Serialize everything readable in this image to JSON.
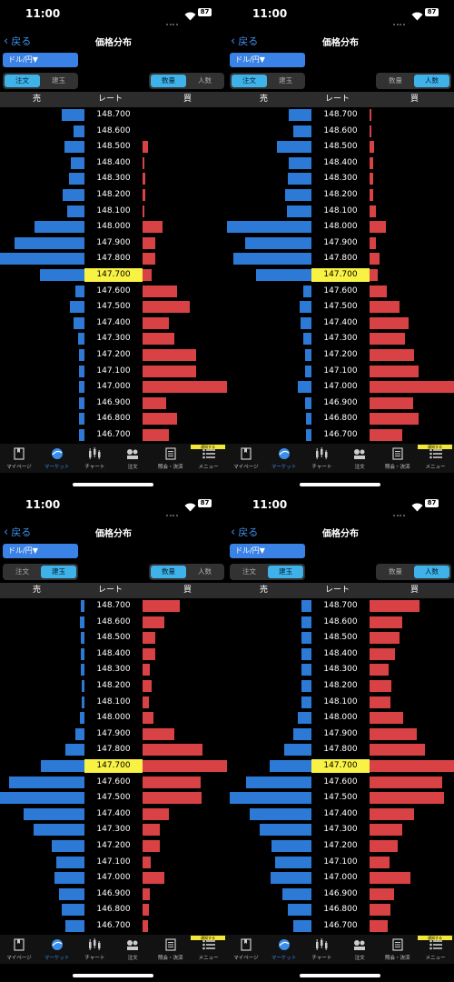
{
  "status": {
    "time": "11:00",
    "battery": "87"
  },
  "nav": {
    "back_label": "戻る",
    "title": "価格分布"
  },
  "pair_selector": "ドル/円▼",
  "toggles": {
    "order_label": "注文",
    "position_label": "建玉",
    "quantity_label": "数量",
    "people_label": "人数"
  },
  "headers": {
    "sell": "売",
    "rate": "レート",
    "buy": "買"
  },
  "prices": [
    "148.700",
    "148.600",
    "148.500",
    "148.400",
    "148.300",
    "148.200",
    "148.100",
    "148.000",
    "147.900",
    "147.800",
    "147.700",
    "147.600",
    "147.500",
    "147.400",
    "147.300",
    "147.200",
    "147.100",
    "147.000",
    "146.900",
    "146.800",
    "146.700"
  ],
  "current_price": "147.700",
  "tabs": [
    {
      "label": "マイページ",
      "icon": "bookmark-icon"
    },
    {
      "label": "マーケット",
      "icon": "market-globe-icon"
    },
    {
      "label": "チャート",
      "icon": "candlestick-icon"
    },
    {
      "label": "注文",
      "icon": "order-icon"
    },
    {
      "label": "照会・決済",
      "icon": "document-icon"
    },
    {
      "label": "メニュー",
      "icon": "menu-list-icon"
    }
  ],
  "menu_badge": "通知する",
  "colors": {
    "sell": "#2c7ad6",
    "buy": "#d94245",
    "current": "#f8f244",
    "accent": "#3b8ee8",
    "toggle_on": "#3fb3e9"
  },
  "panels": [
    {
      "position": "top-left",
      "toggle_left_active": "order",
      "toggle_right_active": "quantity",
      "sell": [
        0.27,
        0.13,
        0.24,
        0.16,
        0.18,
        0.26,
        0.2,
        0.59,
        0.83,
        1.0,
        0.53,
        0.11,
        0.17,
        0.13,
        0.08,
        0.06,
        0.06,
        0.07,
        0.06,
        0.06,
        0.06
      ],
      "buy": [
        0.0,
        0.0,
        0.06,
        0.02,
        0.03,
        0.03,
        0.02,
        0.24,
        0.15,
        0.15,
        0.11,
        0.41,
        0.56,
        0.31,
        0.38,
        0.63,
        0.63,
        1.0,
        0.28,
        0.41,
        0.31
      ]
    },
    {
      "position": "top-right",
      "toggle_left_active": "order",
      "toggle_right_active": "people",
      "sell": [
        0.27,
        0.21,
        0.41,
        0.27,
        0.28,
        0.31,
        0.29,
        1.0,
        0.79,
        0.92,
        0.66,
        0.1,
        0.14,
        0.13,
        0.1,
        0.08,
        0.08,
        0.16,
        0.08,
        0.06,
        0.06
      ],
      "buy": [
        0.02,
        0.02,
        0.05,
        0.04,
        0.04,
        0.04,
        0.08,
        0.19,
        0.08,
        0.12,
        0.1,
        0.2,
        0.35,
        0.46,
        0.42,
        0.53,
        0.58,
        1.0,
        0.52,
        0.58,
        0.39
      ]
    },
    {
      "position": "bottom-left",
      "toggle_left_active": "position",
      "toggle_right_active": "quantity",
      "sell": [
        0.04,
        0.05,
        0.04,
        0.04,
        0.04,
        0.03,
        0.03,
        0.05,
        0.11,
        0.23,
        0.52,
        0.89,
        1.0,
        0.72,
        0.6,
        0.39,
        0.33,
        0.36,
        0.3,
        0.27,
        0.23
      ],
      "buy": [
        0.44,
        0.26,
        0.15,
        0.15,
        0.09,
        0.11,
        0.08,
        0.13,
        0.38,
        0.71,
        1.0,
        0.69,
        0.7,
        0.31,
        0.2,
        0.2,
        0.1,
        0.26,
        0.09,
        0.08,
        0.06
      ]
    },
    {
      "position": "bottom-right",
      "toggle_left_active": "position",
      "toggle_right_active": "people",
      "sell": [
        0.12,
        0.12,
        0.12,
        0.12,
        0.12,
        0.12,
        0.12,
        0.16,
        0.21,
        0.32,
        0.5,
        0.77,
        0.97,
        0.73,
        0.61,
        0.47,
        0.43,
        0.48,
        0.34,
        0.28,
        0.22
      ],
      "buy": [
        0.59,
        0.39,
        0.35,
        0.3,
        0.23,
        0.26,
        0.25,
        0.4,
        0.56,
        0.66,
        1.0,
        0.86,
        0.88,
        0.53,
        0.39,
        0.33,
        0.24,
        0.48,
        0.29,
        0.25,
        0.21
      ]
    }
  ]
}
